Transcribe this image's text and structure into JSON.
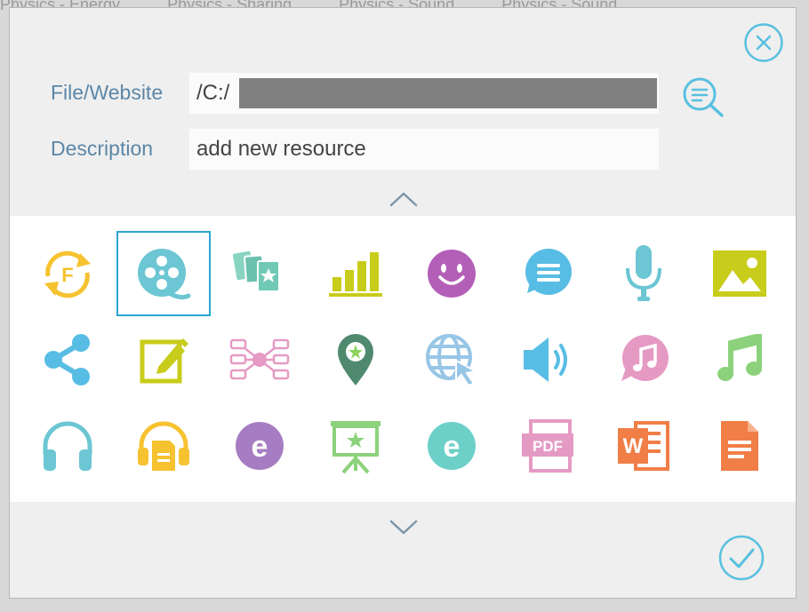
{
  "background": {
    "strip_text": [
      "Physics - Energy",
      "Physics - Sharing",
      "Physics - Sound",
      "Physics - Sound"
    ]
  },
  "dialog": {
    "file_label": "File/Website",
    "file_value": "/C:/",
    "description_label": "Description",
    "description_value": "add new resource"
  },
  "colors": {
    "accent": "#58c0e0",
    "label": "#5b87a8",
    "selection": "#2aa5cf"
  },
  "icons": [
    "flash-refresh-icon",
    "film-reel-icon",
    "flashcards-icon",
    "bar-chart-icon",
    "smiley-icon",
    "speech-bubble-icon",
    "microphone-icon",
    "image-icon",
    "share-icon",
    "edit-note-icon",
    "mind-map-icon",
    "location-pin-icon",
    "web-link-icon",
    "speaker-icon",
    "music-bubble-icon",
    "music-note-icon",
    "headphones-icon",
    "audio-document-icon",
    "ebook-purple-icon",
    "presentation-icon",
    "ebook-teal-icon",
    "pdf-icon",
    "word-document-icon",
    "text-document-icon"
  ],
  "selected_icon": "film-reel-icon"
}
